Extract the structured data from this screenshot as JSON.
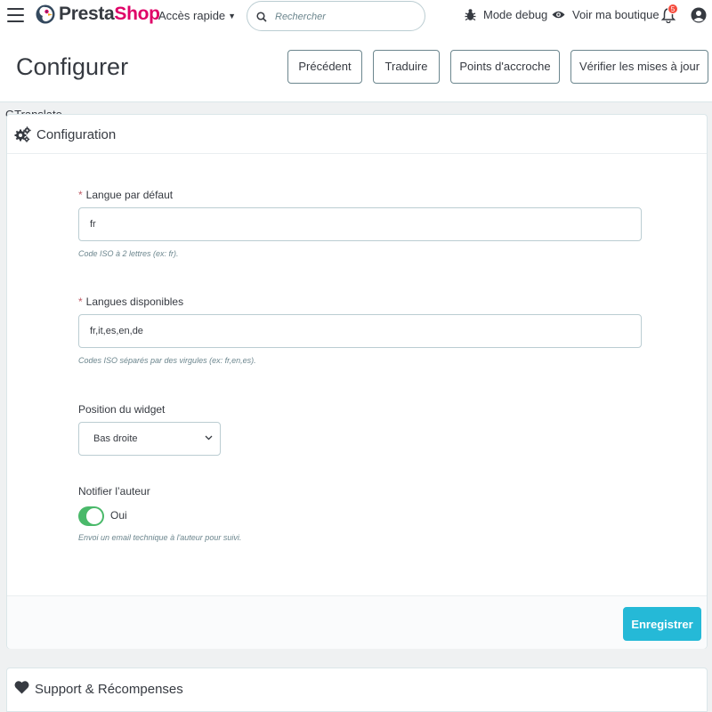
{
  "topbar": {
    "logo_text_presta": "Presta",
    "logo_text_shop": "Shop",
    "quick_access": "Accès rapide",
    "search_placeholder": "Rechercher",
    "debug_mode": "Mode debug",
    "view_shop": "Voir ma boutique",
    "notifications_count": "5"
  },
  "header": {
    "title": "Configurer",
    "buttons": [
      "Précédent",
      "Traduire",
      "Points d'accroche",
      "Vérifier les mises à jour"
    ]
  },
  "module_name": "GTranslate",
  "config_panel": {
    "title": "Configuration",
    "default_language": {
      "label": "Langue par défaut",
      "required_mark": "*",
      "value": "fr",
      "help": "Code ISO à 2 lettres (ex: fr)."
    },
    "available_languages": {
      "label": "Langues disponibles",
      "required_mark": "*",
      "value": "fr,it,es,en,de",
      "help": "Codes ISO séparés par des virgules (ex: fr,en,es)."
    },
    "widget_position": {
      "label": "Position du widget",
      "selected": "Bas droite"
    },
    "notify_author": {
      "label": "Notifier l’auteur",
      "toggle_label": "Oui",
      "enabled": true,
      "help": "Envoi un email technique à l'auteur pour suivi."
    },
    "save_label": "Enregistrer"
  },
  "support_panel": {
    "title": "Support & Récompenses"
  },
  "colors": {
    "brand_pink": "#df0067",
    "accent_blue": "#25b9d7",
    "toggle_green": "#4ab96a",
    "badge_red": "#f54c3e"
  }
}
